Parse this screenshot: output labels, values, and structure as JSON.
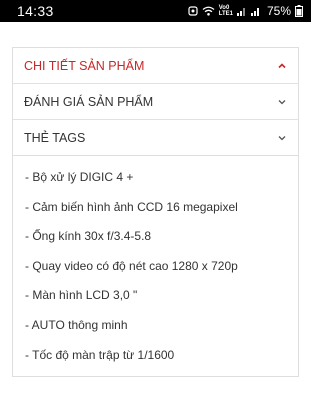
{
  "status_bar": {
    "time": "14:33",
    "volte_top": "Vo0",
    "volte_bottom": "LTE1",
    "battery": "75%"
  },
  "accordion": {
    "sections": [
      {
        "label": "CHI TIẾT SẢN PHẨM",
        "expanded": true
      },
      {
        "label": "ĐÁNH GIÁ SẢN PHẨM",
        "expanded": false
      },
      {
        "label": "THẺ TAGS",
        "expanded": false
      }
    ]
  },
  "specs": [
    "- Bộ xử lý DIGIC 4 +",
    "- Cảm biến hình ảnh CCD 16 megapixel",
    "- Ống kính 30x f/3.4-5.8",
    "- Quay video có độ nét cao 1280 x 720p",
    "- Màn hình LCD 3,0 \"",
    "- AUTO thông minh",
    "- Tốc độ màn trập từ 1/1600"
  ],
  "colors": {
    "accent": "#c62828",
    "border": "#dedede",
    "text": "#333333"
  }
}
